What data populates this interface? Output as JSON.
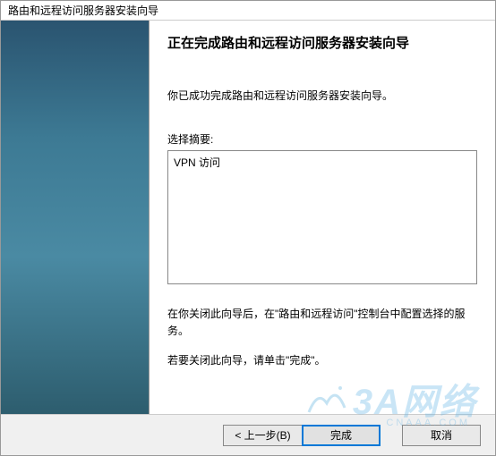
{
  "window": {
    "title": "路由和远程访问服务器安装向导"
  },
  "main": {
    "heading": "正在完成路由和远程访问服务器安装向导",
    "body_text": "你已成功完成路由和远程访问服务器安装向导。",
    "summary_label": "选择摘要:",
    "summary_content": "VPN 访问",
    "instruction": "在你关闭此向导后，在\"路由和远程访问\"控制台中配置选择的服务。",
    "close_hint": "若要关闭此向导，请单击\"完成\"。"
  },
  "buttons": {
    "back": "< 上一步(B)",
    "finish": "完成",
    "cancel": "取消"
  },
  "watermark": {
    "text": "3A网络",
    "sub": "CNAAA.COM"
  }
}
